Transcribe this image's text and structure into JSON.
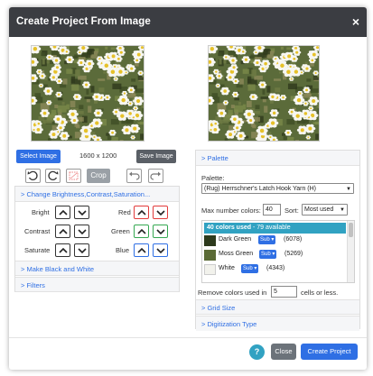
{
  "dialog": {
    "title": "Create Project From Image",
    "close": "×"
  },
  "left": {
    "select_image": "Select Image",
    "dimensions": "1600 x 1200",
    "save_image": "Save Image",
    "crop": "Crop",
    "sections": {
      "brightness": "> Change Brightness,Contrast,Saturation...",
      "black_white": "> Make Black and White",
      "filters": "> Filters"
    },
    "adjust_labels": {
      "bright": "Bright",
      "contrast": "Contrast",
      "saturate": "Saturate",
      "red": "Red",
      "green": "Green",
      "blue": "Blue"
    }
  },
  "right": {
    "palette_header": "> Palette",
    "palette_label": "Palette:",
    "palette_value": "(Rug) Herrschner's Latch Hook Yarn (H)",
    "max_colors_label": "Max number colors:",
    "max_colors_value": "40",
    "sort_label": "Sort:",
    "sort_value": "Most used",
    "colors_used_bold": "40 colors used",
    "colors_used_rest": " - 79 available",
    "rows": [
      {
        "name": "Dark Green",
        "sub": "Sub ▾",
        "count": "(6078)",
        "color": "#2d3a1c"
      },
      {
        "name": "Moss Green",
        "sub": "Sub ▾",
        "count": "(5269)",
        "color": "#5a6a35"
      },
      {
        "name": "White",
        "sub": "Sub ▾",
        "count": "(4343)",
        "color": "#f2f2ec"
      }
    ],
    "remove_prefix": "Remove colors used in",
    "remove_value": "5",
    "remove_suffix": "cells or less.",
    "grid_size": "> Grid Size",
    "digitization": "> Digitization Type"
  },
  "footer": {
    "help": "?",
    "close": "Close",
    "create": "Create Project"
  },
  "colors": {
    "accent": "#2f6fe4",
    "titlebar": "#3b3d42",
    "list_header": "#31a2c2"
  }
}
